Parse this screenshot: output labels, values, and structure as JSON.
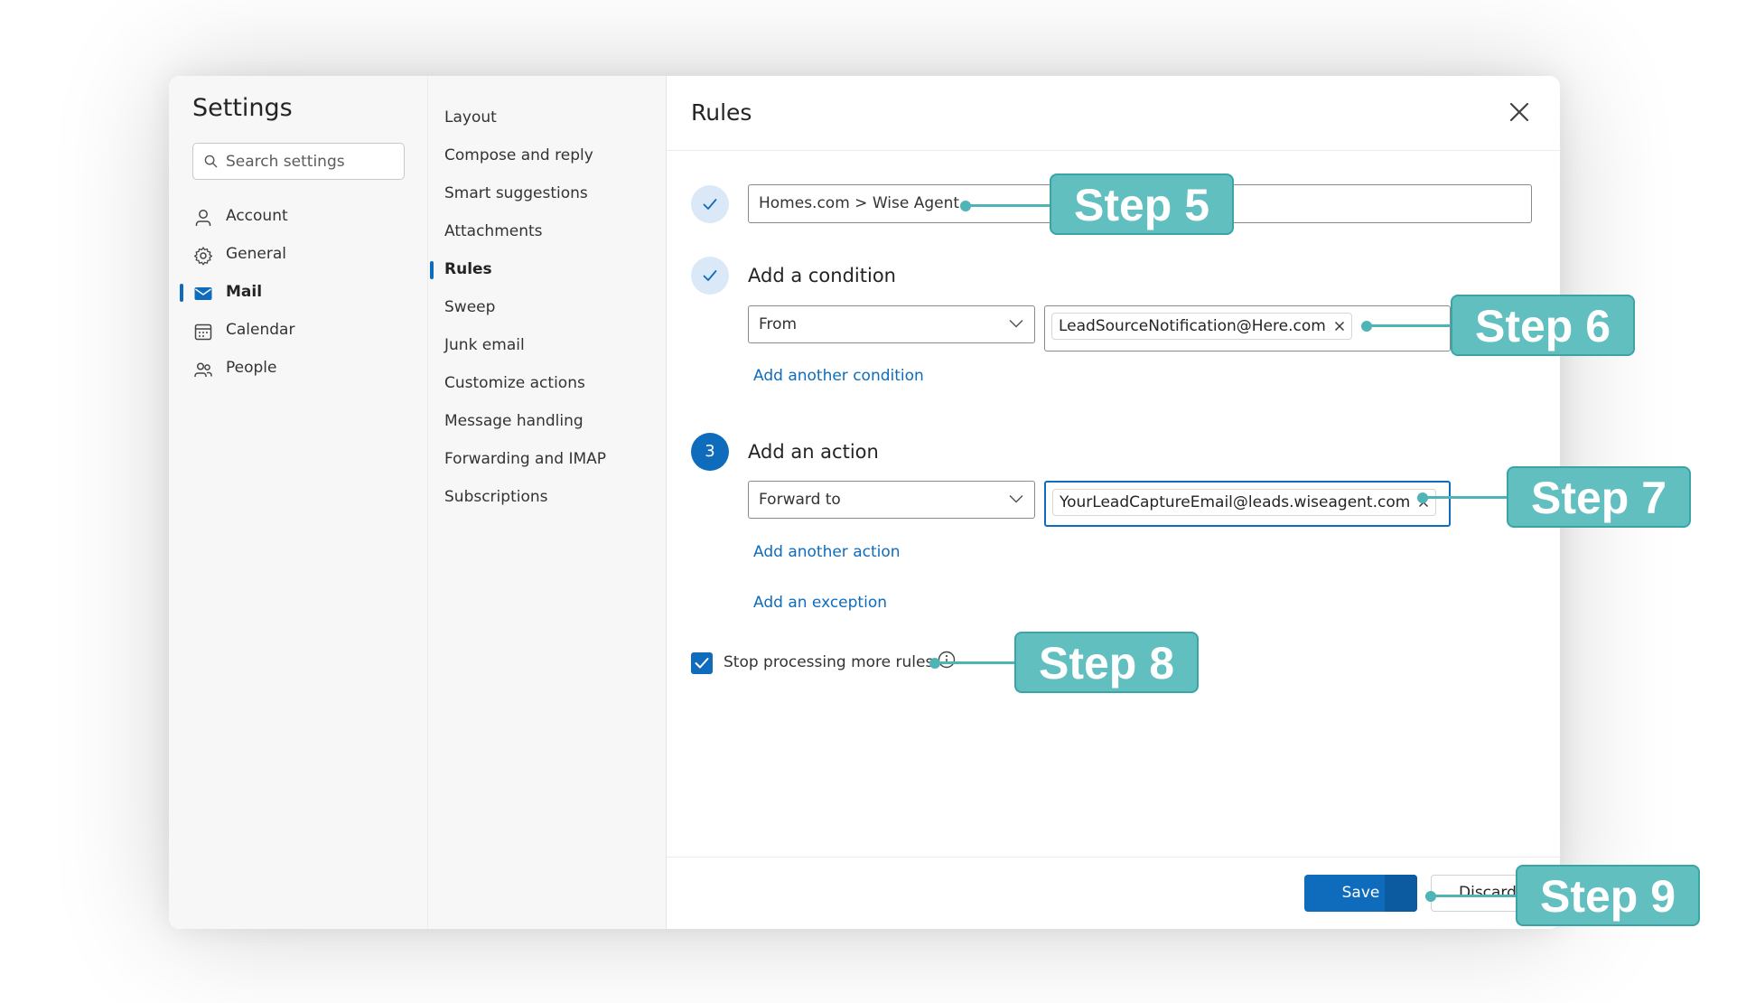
{
  "settings": {
    "title": "Settings",
    "search_placeholder": "Search settings",
    "nav": [
      {
        "label": "Account",
        "icon": "person-icon"
      },
      {
        "label": "General",
        "icon": "gear-icon"
      },
      {
        "label": "Mail",
        "icon": "mail-icon",
        "active": true
      },
      {
        "label": "Calendar",
        "icon": "calendar-icon"
      },
      {
        "label": "People",
        "icon": "people-icon"
      }
    ]
  },
  "mail_menu": [
    {
      "label": "Layout"
    },
    {
      "label": "Compose and reply"
    },
    {
      "label": "Smart suggestions"
    },
    {
      "label": "Attachments"
    },
    {
      "label": "Rules",
      "active": true
    },
    {
      "label": "Sweep"
    },
    {
      "label": "Junk email"
    },
    {
      "label": "Customize actions"
    },
    {
      "label": "Message handling"
    },
    {
      "label": "Forwarding and IMAP"
    },
    {
      "label": "Subscriptions"
    }
  ],
  "rules": {
    "title": "Rules",
    "rule_name": "Homes.com > Wise Agent",
    "condition_label": "Add a condition",
    "condition_field": "From",
    "condition_value": "LeadSourceNotification@Here.com",
    "add_condition_link": "Add another condition",
    "action_step_number": "3",
    "action_label": "Add an action",
    "action_field": "Forward to",
    "action_value": "YourLeadCaptureEmail@leads.wiseagent.com",
    "add_action_link": "Add another action",
    "add_exception_link": "Add an exception",
    "stop_processing_label": "Stop processing more rules",
    "stop_processing_checked": true,
    "save_label": "Save",
    "discard_label": "Discard"
  },
  "callouts": {
    "step5": "Step 5",
    "step6": "Step 6",
    "step7": "Step 7",
    "step8": "Step 8",
    "step9": "Step 9"
  },
  "colors": {
    "accent": "#0f6cbd",
    "callout": "#62bfc0",
    "step_done_bg": "#dbe8f7"
  }
}
